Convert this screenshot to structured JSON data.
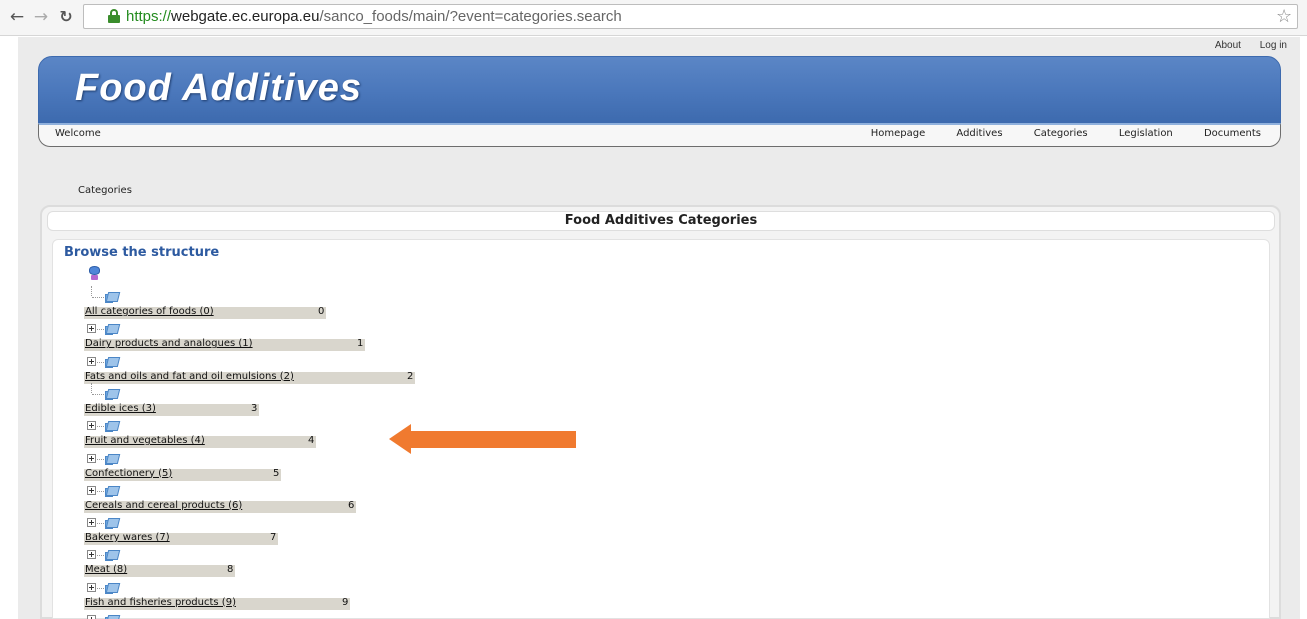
{
  "browser": {
    "url_scheme": "https://",
    "url_host": "webgate.ec.europa.eu",
    "url_path": "/sanco_foods/main/?event=categories.search",
    "back_icon": "back-arrow-icon",
    "forward_icon": "forward-arrow-icon",
    "reload_icon": "reload-icon",
    "bookmark_icon": "star-icon"
  },
  "util_links": {
    "about": "About",
    "login": "Log in"
  },
  "banner": {
    "title": "Food Additives"
  },
  "menu": {
    "welcome": "Welcome",
    "items": [
      "Homepage",
      "Additives",
      "Categories",
      "Legislation",
      "Documents"
    ]
  },
  "breadcrumb": "Categories",
  "panel": {
    "title": "Food Additives Categories",
    "browse_title": "Browse the structure"
  },
  "tree": [
    {
      "label": "All categories of foods (0)",
      "count": "0",
      "expandable": false
    },
    {
      "label": "Dairy products and analogues (1)",
      "count": "1",
      "expandable": true
    },
    {
      "label": "Fats and oils and fat and oil emulsions (2)",
      "count": "2",
      "expandable": true
    },
    {
      "label": "Edible ices (3)",
      "count": "3",
      "expandable": false
    },
    {
      "label": "Fruit and vegetables (4)",
      "count": "4",
      "expandable": true
    },
    {
      "label": "Confectionery (5)",
      "count": "5",
      "expandable": true
    },
    {
      "label": "Cereals and cereal products (6)",
      "count": "6",
      "expandable": true
    },
    {
      "label": "Bakery wares (7)",
      "count": "7",
      "expandable": true
    },
    {
      "label": "Meat (8)",
      "count": "8",
      "expandable": true
    },
    {
      "label": "Fish and fisheries products (9)",
      "count": "9",
      "expandable": true
    },
    {
      "label": "",
      "count": "",
      "expandable": true
    }
  ],
  "colors": {
    "banner": "#4a77bb",
    "arrow": "#f07a2f",
    "link": "#2d5aa0",
    "bar": "#d9d6cd"
  }
}
